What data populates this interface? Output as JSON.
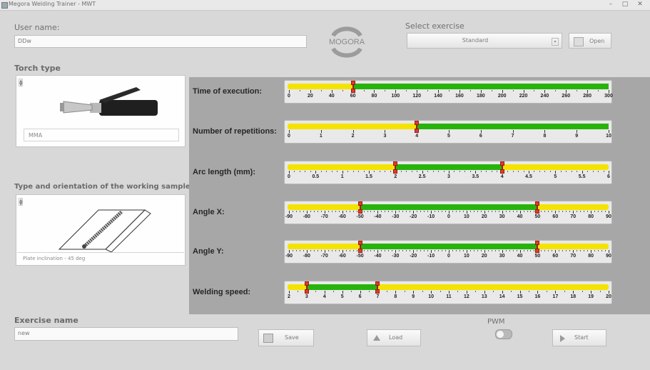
{
  "window": {
    "title": "Megora Welding Trainer - MWT",
    "minimize": "–",
    "maximize": "□",
    "close": "✕"
  },
  "user": {
    "label": "User name:",
    "value": "DDw"
  },
  "logo": {
    "text": "MOGORA"
  },
  "exercise_select": {
    "label": "Select exercise",
    "value": "Standard",
    "open_label": "Open"
  },
  "torch": {
    "label": "Torch type",
    "caption": "MMA"
  },
  "sample": {
    "label": "Type and orientation of the working sample",
    "caption": "Plate inclination - 45 deg"
  },
  "exercise_name": {
    "label": "Exercise name",
    "value": "new"
  },
  "buttons": {
    "save": "Save",
    "load": "Load",
    "start": "Start"
  },
  "pwm": {
    "label": "PWM"
  },
  "params": [
    {
      "label": "Time of execution:",
      "min": 0,
      "max": 300,
      "major": 20,
      "minor": 10,
      "range": [
        60,
        300
      ],
      "low_marker": 60,
      "high_marker": null,
      "ticks": [
        "0",
        "20",
        "40",
        "60",
        "80",
        "100",
        "120",
        "140",
        "160",
        "180",
        "200",
        "220",
        "240",
        "260",
        "280",
        "300"
      ]
    },
    {
      "label": "Number of repetitions:",
      "min": 0,
      "max": 10,
      "major": 1,
      "minor": 1,
      "range": [
        4,
        10
      ],
      "low_marker": 4,
      "high_marker": null,
      "ticks": [
        "0",
        "1",
        "2",
        "3",
        "4",
        "5",
        "6",
        "7",
        "8",
        "9",
        "10"
      ]
    },
    {
      "label": "Arc length (mm):",
      "min": 0,
      "max": 6,
      "major": 0.5,
      "minor": 0.1,
      "range": [
        2,
        4
      ],
      "low_marker": 2,
      "high_marker": 4,
      "ticks": [
        "0",
        "0.5",
        "1",
        "1.5",
        "2",
        "2.5",
        "3",
        "3.5",
        "4",
        "4.5",
        "5",
        "5.5",
        "6"
      ]
    },
    {
      "label": "Angle X:",
      "min": -90,
      "max": 90,
      "major": 10,
      "minor": 2,
      "range": [
        -50,
        50
      ],
      "low_marker": -50,
      "high_marker": 50,
      "ticks": [
        "-90",
        "-80",
        "-70",
        "-60",
        "-50",
        "-40",
        "-30",
        "-20",
        "-10",
        "0",
        "10",
        "20",
        "30",
        "40",
        "50",
        "60",
        "70",
        "80",
        "90"
      ]
    },
    {
      "label": "Angle Y:",
      "min": -90,
      "max": 90,
      "major": 10,
      "minor": 2,
      "range": [
        -50,
        50
      ],
      "low_marker": -50,
      "high_marker": 50,
      "ticks": [
        "-90",
        "-80",
        "-70",
        "-60",
        "-50",
        "-40",
        "-30",
        "-20",
        "-10",
        "0",
        "10",
        "20",
        "30",
        "40",
        "50",
        "60",
        "70",
        "80",
        "90"
      ]
    },
    {
      "label": "Welding speed:",
      "min": 2,
      "max": 20,
      "major": 1,
      "minor": 0.5,
      "range": [
        3,
        7
      ],
      "low_marker": 3,
      "high_marker": 7,
      "ticks": [
        "2",
        "3",
        "4",
        "5",
        "6",
        "7",
        "8",
        "9",
        "10",
        "11",
        "12",
        "13",
        "14",
        "15",
        "16",
        "17",
        "18",
        "19",
        "20"
      ]
    }
  ],
  "colors": {
    "track": "#f4e300",
    "ok_range": "#27b30c",
    "marker": "#e03b2a",
    "panel_bg": "#a7a7a7"
  }
}
